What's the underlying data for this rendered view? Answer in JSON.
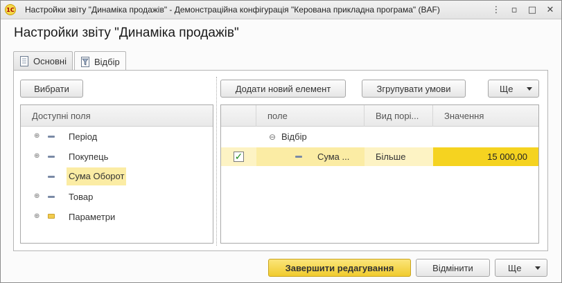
{
  "window": {
    "title": "Настройки звіту \"Динаміка продажів\" - Демонстраційна конфігурація \"Керована прикладна програма\"  (BAF)",
    "app_icon": "1C",
    "controls": {
      "menu": "⋮",
      "minimize": "▫",
      "maximize": "□",
      "close": "✕"
    }
  },
  "page_title": "Настройки звіту \"Динаміка продажів\"",
  "tabs": [
    {
      "label": "Основні",
      "icon": "document-icon",
      "active": false
    },
    {
      "label": "Відбір",
      "icon": "filter-icon",
      "active": true
    }
  ],
  "left": {
    "select_button": "Вибрати",
    "header": "Доступні поля",
    "items": [
      {
        "label": "Період",
        "expandable": true,
        "icon": "attribute-icon",
        "selected": false
      },
      {
        "label": "Покупець",
        "expandable": true,
        "icon": "attribute-icon",
        "selected": false
      },
      {
        "label": "Сума Оборот",
        "expandable": false,
        "icon": "attribute-icon",
        "selected": true
      },
      {
        "label": "Товар",
        "expandable": true,
        "icon": "attribute-icon",
        "selected": false
      },
      {
        "label": "Параметри",
        "expandable": true,
        "icon": "folder-icon",
        "selected": false
      }
    ]
  },
  "right": {
    "add_button": "Додати новий елемент",
    "group_button": "Згрупувати умови",
    "more_button": "Ще",
    "columns": [
      "",
      "поле",
      "Вид порі...",
      "Значення"
    ],
    "group_row": {
      "label": "Відбір",
      "collapse_glyph": "⊖"
    },
    "rows": [
      {
        "checked": true,
        "field": "Сума ...",
        "comparison": "Більше",
        "value": "15 000,00"
      }
    ]
  },
  "footer": {
    "finish_button": "Завершити редагування",
    "cancel_button": "Відмінити",
    "more_button": "Ще"
  },
  "colors": {
    "accent": "#f0cb2e",
    "selection": "#fbeca4",
    "value_highlight": "#f5d320"
  }
}
